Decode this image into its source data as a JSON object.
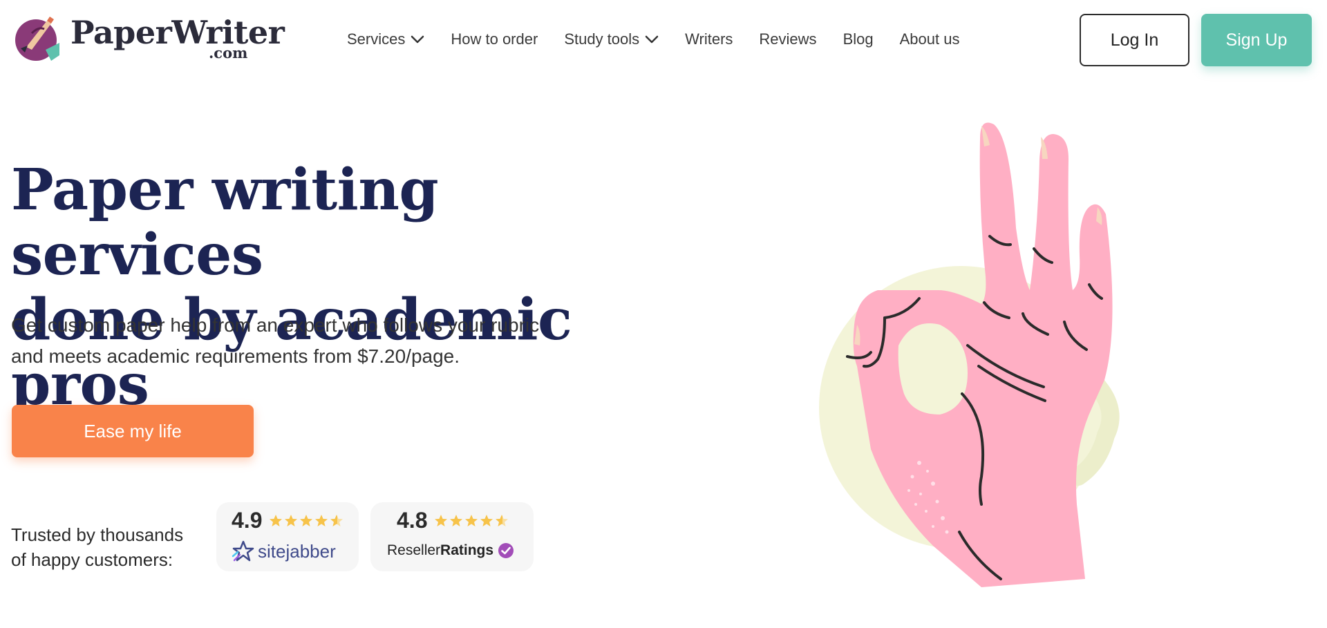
{
  "brand": {
    "name": "PaperWriter",
    "domain": ".com"
  },
  "nav": {
    "items": [
      {
        "label": "Services",
        "has_dropdown": true
      },
      {
        "label": "How to order",
        "has_dropdown": false
      },
      {
        "label": "Study tools",
        "has_dropdown": true
      },
      {
        "label": "Writers",
        "has_dropdown": false
      },
      {
        "label": "Reviews",
        "has_dropdown": false
      },
      {
        "label": "Blog",
        "has_dropdown": false
      },
      {
        "label": "About us",
        "has_dropdown": false
      }
    ],
    "login_label": "Log In",
    "signup_label": "Sign Up"
  },
  "hero": {
    "title_line1": "Paper writing services",
    "title_line2": "done by academic pros",
    "subtitle_line1": "Get custom paper help from an expert who follows your rubric",
    "subtitle_line2": "and meets academic requirements from $7.20/page.",
    "cta_label": "Ease my life"
  },
  "trust": {
    "label_line1": "Trusted by thousands",
    "label_line2": "of happy customers:",
    "ratings": [
      {
        "score": "4.9",
        "stars": 4.5,
        "platform": "sitejabber"
      },
      {
        "score": "4.8",
        "stars": 4.5,
        "platform_prefix": "Reseller",
        "platform_bold": "Ratings"
      }
    ]
  },
  "colors": {
    "accent_teal": "#5fc1ad",
    "cta_orange": "#f9834a",
    "title_navy": "#1c2453",
    "star_gold": "#f7c34a",
    "hand_pink": "#ffafc4",
    "circle_cream": "#f3f4d8"
  },
  "icons": {
    "logo": "quill-pen-logo-icon",
    "dropdown": "chevron-down-icon",
    "star": "star-icon",
    "sitejabber": "sitejabber-star-icon",
    "reseller": "verified-check-icon",
    "illustration": "ok-hand-gesture-illustration"
  }
}
